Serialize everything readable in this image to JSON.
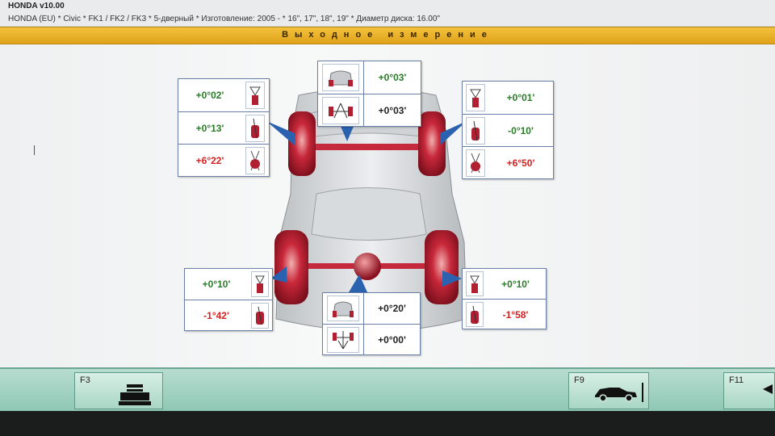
{
  "header": {
    "app_title": "HONDA v10.00",
    "vehicle_line": "HONDA (EU) * Civic * FK1 / FK2 / FK3 * 5-дверный * Изготовление: 2005 - * 16\", 17\", 18\", 19\" * Диаметр диска: 16.00\""
  },
  "screen_title": "Выходное измерение",
  "front": {
    "center": {
      "value1": "+0°03'",
      "value2": "+0°03'"
    },
    "left": {
      "camber": "+0°02'",
      "caster": "+0°13'",
      "sai": "+6°22'"
    },
    "right": {
      "camber": "+0°01'",
      "caster": "-0°10'",
      "sai": "+6°50'"
    }
  },
  "rear": {
    "center": {
      "value1": "+0°20'",
      "value2": "+0°00'"
    },
    "left": {
      "toe": "+0°10'",
      "camber": "-1°42'"
    },
    "right": {
      "toe": "+0°10'",
      "camber": "-1°58'"
    }
  },
  "colors": {
    "ok": "#2a7a2a",
    "out": "#d62020",
    "accent": "#e0a21a"
  },
  "footer": {
    "f3_label": "F3",
    "f9_label": "F9",
    "f11_label": "F11",
    "icons": {
      "f3": "printer-icon",
      "f9": "car-lift-icon",
      "f11": "back-arrow-icon"
    }
  }
}
